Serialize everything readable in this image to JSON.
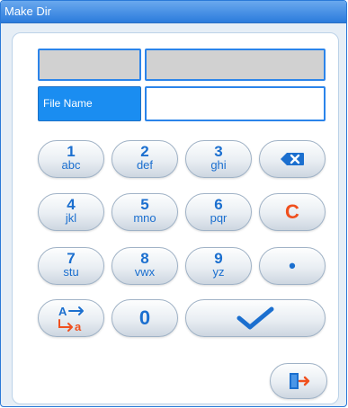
{
  "window": {
    "title": "Make Dir"
  },
  "form": {
    "label": "File Name",
    "value": ""
  },
  "keypad": {
    "keys": [
      {
        "num": "1",
        "letters": "abc"
      },
      {
        "num": "2",
        "letters": "def"
      },
      {
        "num": "3",
        "letters": "ghi"
      },
      {
        "num": "4",
        "letters": "jkl"
      },
      {
        "num": "5",
        "letters": "mno"
      },
      {
        "num": "6",
        "letters": "pqr"
      },
      {
        "num": "7",
        "letters": "stu"
      },
      {
        "num": "8",
        "letters": "vwx"
      },
      {
        "num": "9",
        "letters": "yz"
      },
      {
        "num": "0",
        "letters": ""
      }
    ],
    "clear_label": "C",
    "dot_label": "•",
    "toggle_labels": {
      "upper": "A",
      "lower": "a"
    }
  },
  "icons": {
    "backspace": "backspace-icon",
    "confirm": "checkmark-icon",
    "exit": "exit-door-icon",
    "case_toggle": "case-toggle-icon"
  },
  "colors": {
    "title_bar": "#2b7bdc",
    "accent_blue": "#1b6fcf",
    "label_bg": "#1a8df1",
    "clear_key": "#f0501e"
  }
}
